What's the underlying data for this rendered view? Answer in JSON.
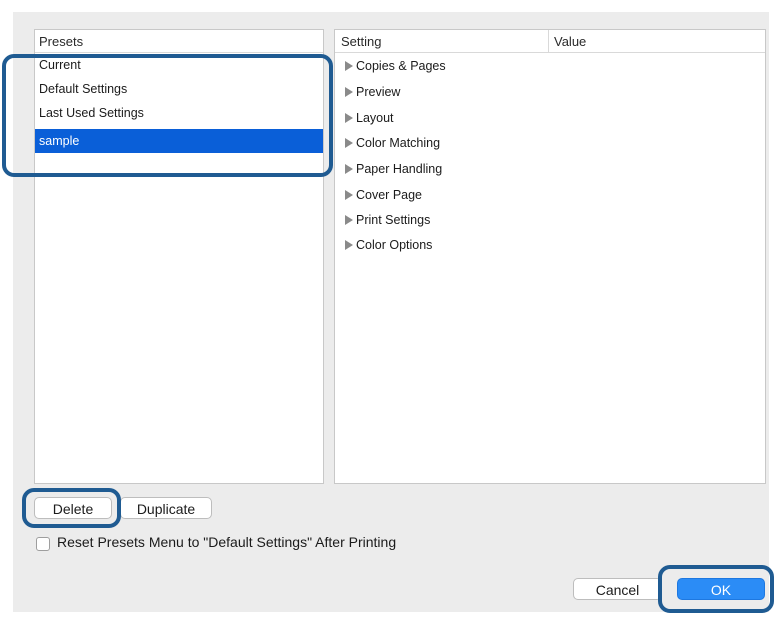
{
  "presets_panel": {
    "header": "Presets",
    "items": [
      {
        "label": "Current",
        "selected": false
      },
      {
        "label": "Default Settings",
        "selected": false
      },
      {
        "label": "Last Used Settings",
        "selected": false
      },
      {
        "label": "sample",
        "selected": true
      }
    ]
  },
  "settings_panel": {
    "columns": [
      "Setting",
      "Value"
    ],
    "rows": [
      {
        "label": "Copies & Pages"
      },
      {
        "label": "Preview"
      },
      {
        "label": "Layout"
      },
      {
        "label": "Color Matching"
      },
      {
        "label": "Paper Handling"
      },
      {
        "label": "Cover Page"
      },
      {
        "label": "Print Settings"
      },
      {
        "label": "Color Options"
      }
    ]
  },
  "buttons": {
    "delete": "Delete",
    "duplicate": "Duplicate",
    "cancel": "Cancel",
    "ok": "OK"
  },
  "reset_checkbox": {
    "label": "Reset Presets Menu to \"Default Settings\" After Printing",
    "checked": false
  },
  "colors": {
    "selection": "#0a5fd8",
    "primary_button": "#2b8cf6",
    "highlight_ring": "#1f5b92"
  }
}
